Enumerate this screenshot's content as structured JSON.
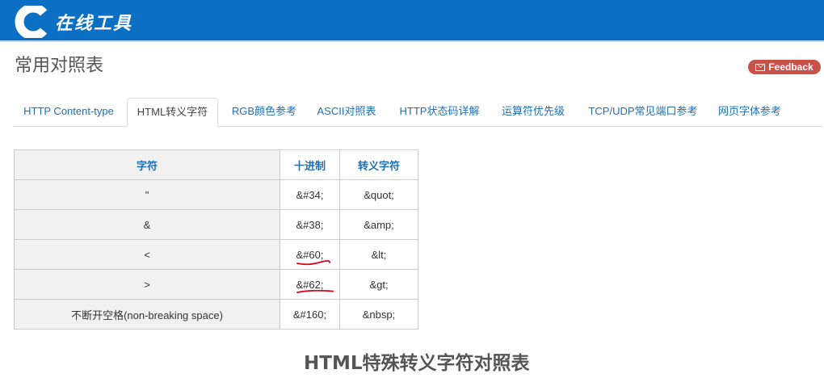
{
  "header": {
    "logo_text": "在线工具",
    "brand_color": "#0b6fc4"
  },
  "page": {
    "title": "常用对照表",
    "feedback_label": "Feedback",
    "feedback_icon": "mail-icon",
    "feedback_color": "#c9514a"
  },
  "tabs": [
    {
      "label": "HTTP Content-type"
    },
    {
      "label": "HTML转义字符"
    },
    {
      "label": "RGB颜色参考"
    },
    {
      "label": "ASCII对照表"
    },
    {
      "label": "HTTP状态码详解"
    },
    {
      "label": "运算符优先级"
    },
    {
      "label": "TCP/UDP常见端口参考"
    },
    {
      "label": "网页字体参考"
    }
  ],
  "active_tab": "HTML转义字符",
  "table": {
    "headers": [
      "字符",
      "十进制",
      "转义字符"
    ],
    "rows": [
      [
        "\"",
        "&#34;",
        "&quot;"
      ],
      [
        "&",
        "&#38;",
        "&amp;"
      ],
      [
        "<",
        "&#60;",
        "&lt;"
      ],
      [
        ">",
        "&#62;",
        "&gt;"
      ],
      [
        "不断开空格(non-breaking space)",
        "&#160;",
        "&nbsp;"
      ]
    ]
  },
  "annotation_color": "#e0001b",
  "section_title": "HTML特殊转义字符对照表"
}
